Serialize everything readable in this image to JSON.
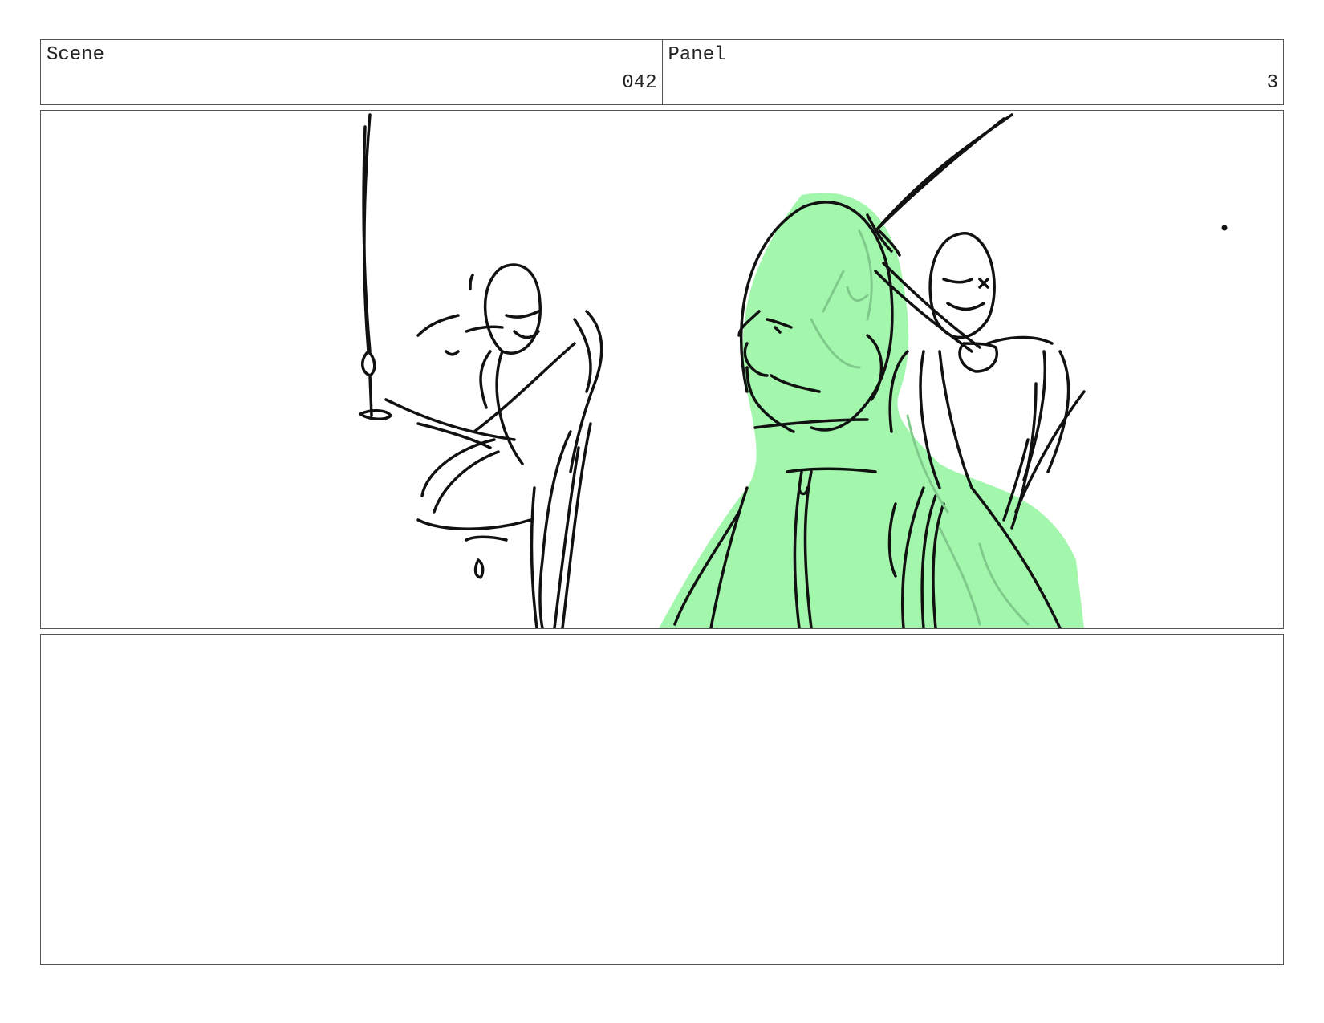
{
  "header": {
    "scene": {
      "label": "Scene",
      "value": "042"
    },
    "panel": {
      "label": "Panel",
      "value": "3"
    }
  },
  "artwork": {
    "fill_color": "#a3f7ad",
    "line_color": "#111111",
    "shadow_line_color": "#7fc98a"
  },
  "notes": {
    "text": ""
  }
}
